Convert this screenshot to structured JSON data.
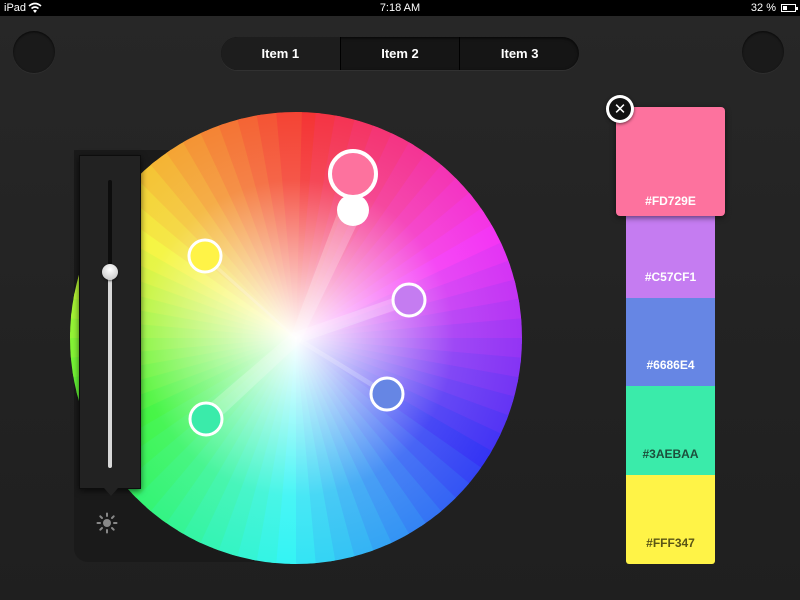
{
  "status_bar": {
    "device": "iPad",
    "time": "7:18 AM",
    "battery_text": "32 %",
    "battery_level": 0.32
  },
  "segmented_control": {
    "items": [
      "Item 1",
      "Item 2",
      "Item 3"
    ],
    "selected": 0
  },
  "brightness_slider": {
    "value": 0.68
  },
  "harmony_handles": [
    {
      "name": "handle-primary",
      "color": "#FD729E"
    },
    {
      "name": "handle-purple",
      "color": "#C57CF1"
    },
    {
      "name": "handle-blue",
      "color": "#6686E4"
    },
    {
      "name": "handle-green",
      "color": "#3AEBAA"
    },
    {
      "name": "handle-yellow",
      "color": "#FFF347"
    }
  ],
  "swatches": [
    {
      "label": "#FD729E",
      "color": "#FD729E",
      "text_color": "#ffffff",
      "selected": true
    },
    {
      "label": "#C57CF1",
      "color": "#C57CF1",
      "text_color": "#ffffff"
    },
    {
      "label": "#6686E4",
      "color": "#6686E4",
      "text_color": "#ffffff"
    },
    {
      "label": "#3AEBAA",
      "color": "#3AEBAA",
      "text_color": "#1c4f3c"
    },
    {
      "label": "#FFF347",
      "color": "#FFF347",
      "text_color": "#5a5515"
    }
  ],
  "icons": {
    "remove": "close-icon",
    "brightness": "brightness-icon",
    "wifi": "wifi-icon",
    "battery": "battery-icon"
  }
}
